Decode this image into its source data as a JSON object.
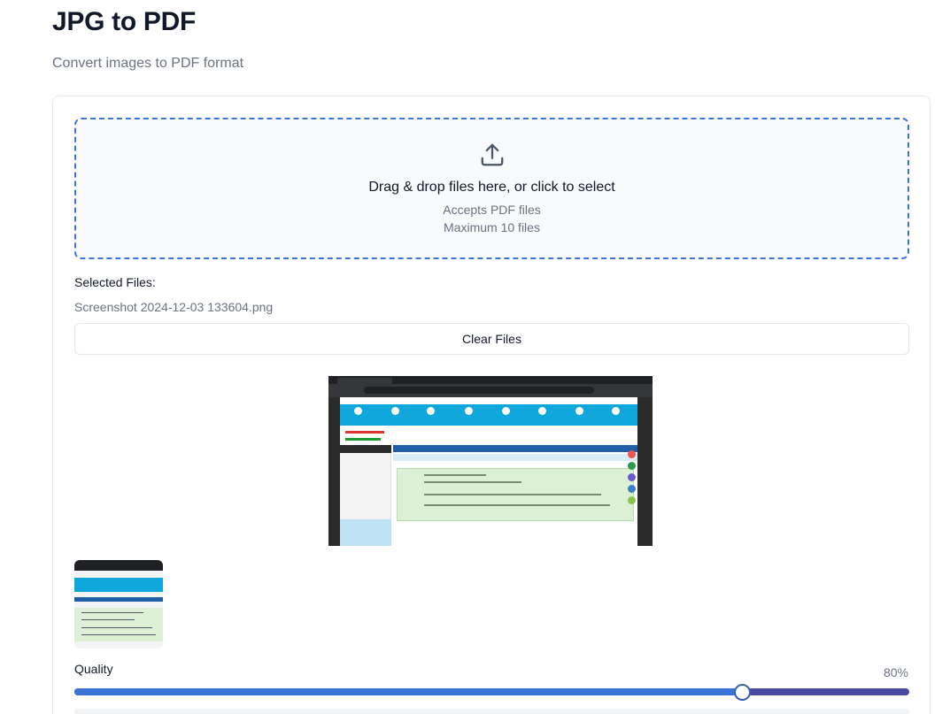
{
  "header": {
    "title": "JPG to PDF",
    "subtitle": "Convert images to PDF format"
  },
  "dropzone": {
    "icon": "upload-icon",
    "main_text": "Drag & drop files here, or click to select",
    "accepts_text": "Accepts PDF files",
    "max_text": "Maximum 10 files"
  },
  "files": {
    "label": "Selected Files:",
    "items": [
      "Screenshot 2024-12-03 133604.png"
    ],
    "clear_label": "Clear Files"
  },
  "quality": {
    "label": "Quality",
    "value_text": "80%",
    "value": 0.8
  },
  "colors": {
    "accent": "#3b73d6",
    "track": "#4b4aa0",
    "muted_text": "#6b7280"
  }
}
